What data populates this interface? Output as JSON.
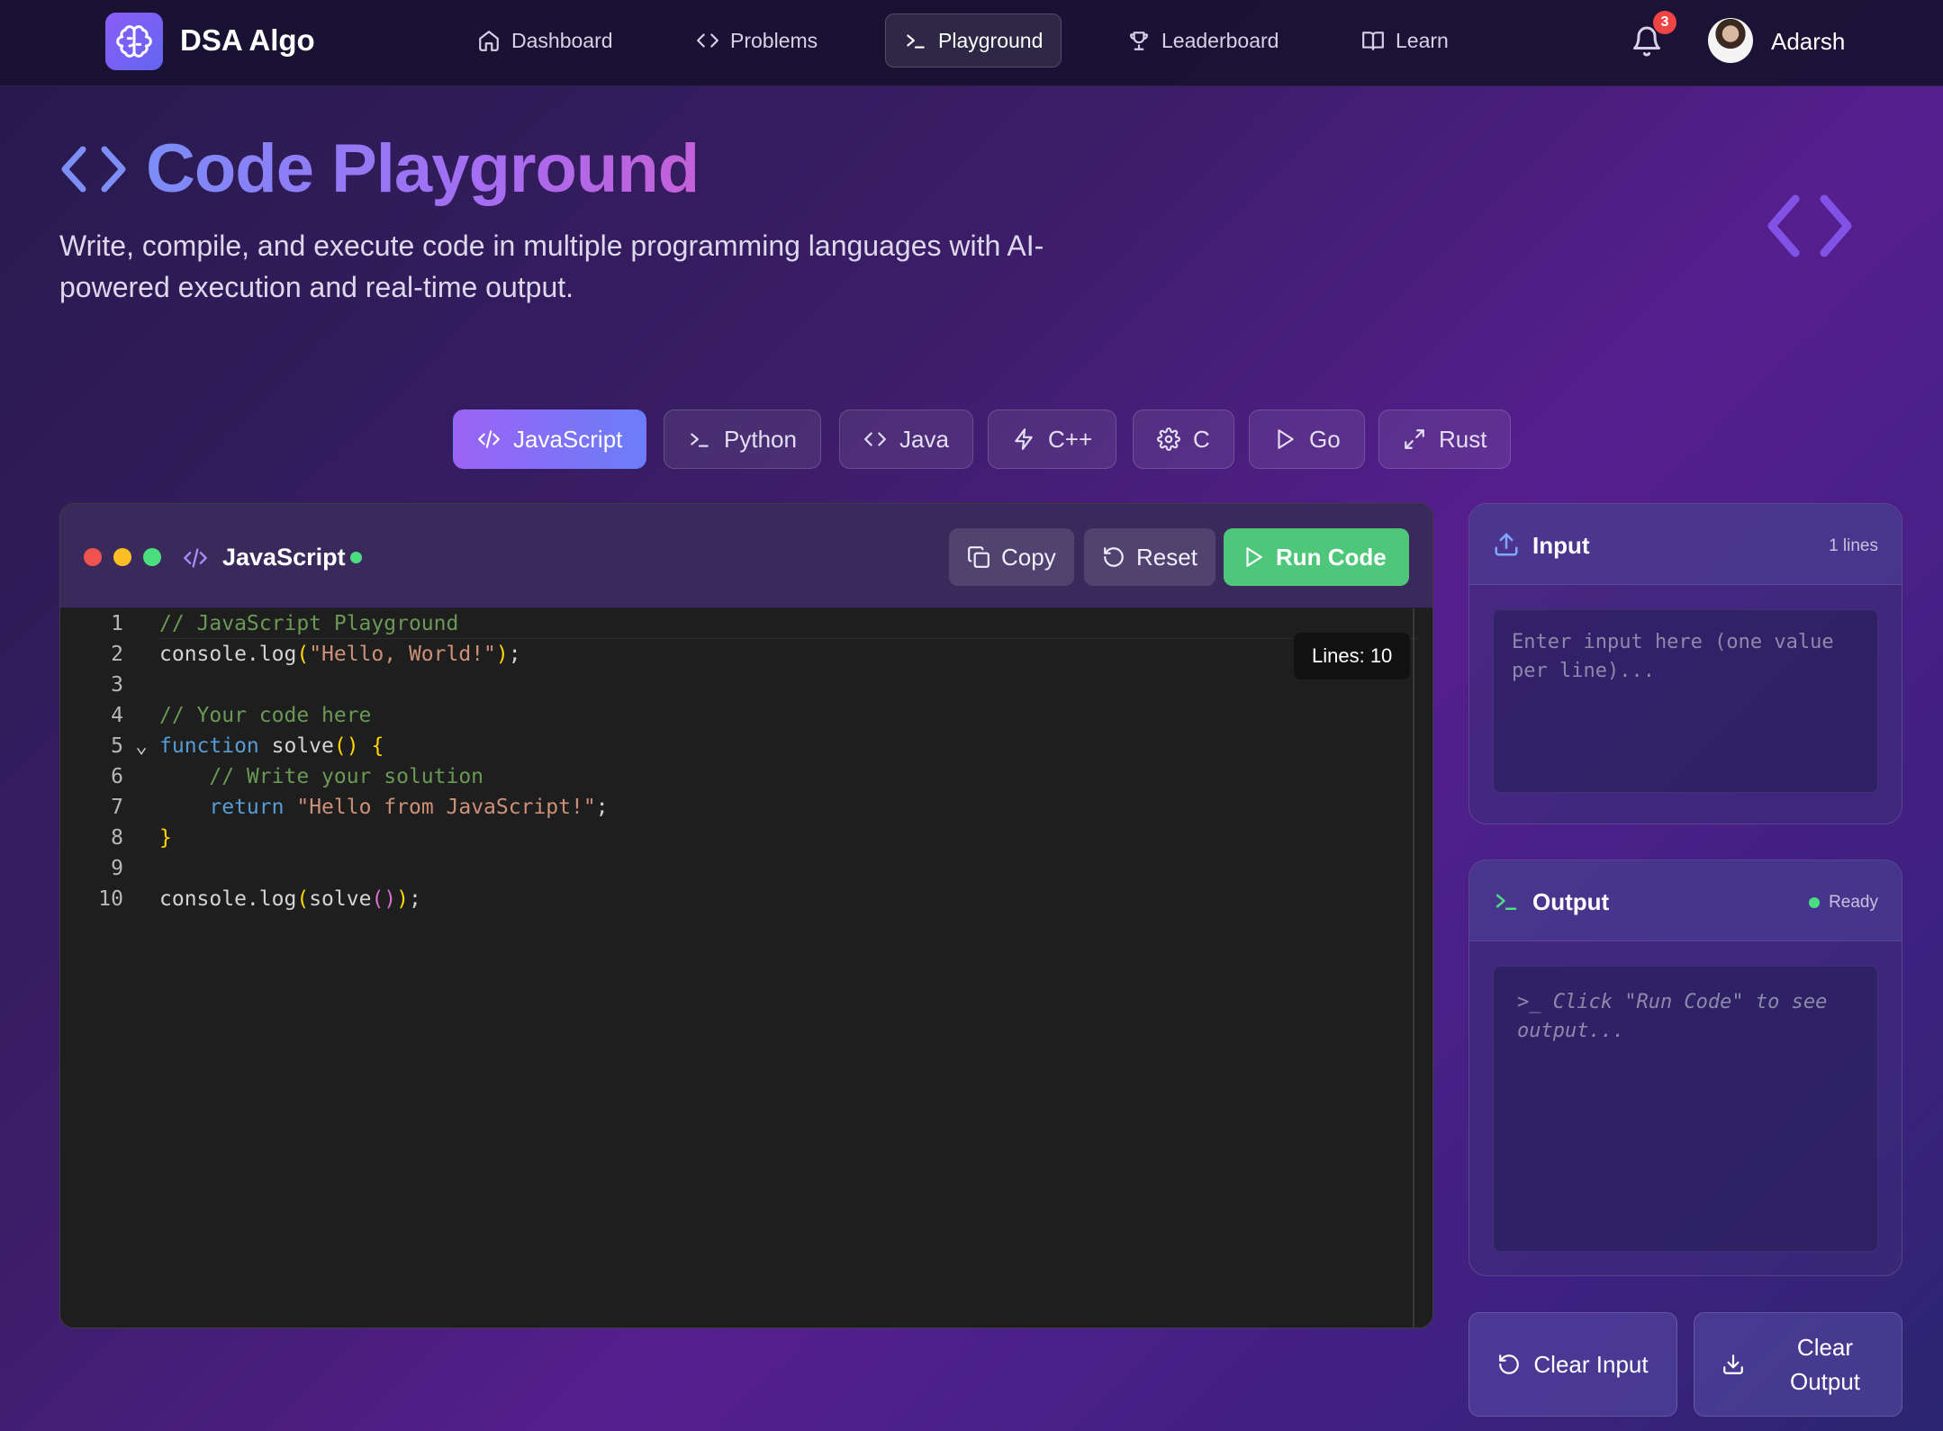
{
  "nav": {
    "brand": "DSA Algo",
    "items": [
      {
        "label": "Dashboard",
        "icon": "home-icon"
      },
      {
        "label": "Problems",
        "icon": "code-icon"
      },
      {
        "label": "Playground",
        "icon": "terminal-icon",
        "active": true
      },
      {
        "label": "Leaderboard",
        "icon": "trophy-icon"
      },
      {
        "label": "Learn",
        "icon": "book-icon"
      }
    ],
    "notifications": "3",
    "user": "Adarsh"
  },
  "hero": {
    "title": "Code Playground",
    "subtitle": "Write, compile, and execute code in multiple programming languages with AI-powered execution and real-time output."
  },
  "languages": [
    {
      "label": "JavaScript",
      "icon": "code-slash-icon",
      "active": true
    },
    {
      "label": "Python",
      "icon": "terminal-icon"
    },
    {
      "label": "Java",
      "icon": "code-icon"
    },
    {
      "label": "C++",
      "icon": "zap-icon"
    },
    {
      "label": "C",
      "icon": "gear-icon"
    },
    {
      "label": "Go",
      "icon": "play-icon"
    },
    {
      "label": "Rust",
      "icon": "expand-icon"
    }
  ],
  "editor": {
    "language": "JavaScript",
    "copy_label": "Copy",
    "reset_label": "Reset",
    "run_label": "Run Code",
    "lines_badge": "Lines: 10",
    "line_numbers": [
      "1",
      "2",
      "3",
      "4",
      "5",
      "6",
      "7",
      "8",
      "9",
      "10"
    ]
  },
  "input_panel": {
    "title": "Input",
    "meta": "1 lines",
    "placeholder": "Enter input here (one value per line)..."
  },
  "output_panel": {
    "title": "Output",
    "status": "Ready",
    "placeholder": ">_ Click \"Run Code\" to see output..."
  },
  "actions": {
    "clear_input": "Clear Input",
    "clear_output": "Clear Output"
  },
  "colors": {
    "accent": "#8b5cf6",
    "run": "#4ec77b",
    "status_ok": "#4ade80",
    "badge": "#ef4444"
  }
}
